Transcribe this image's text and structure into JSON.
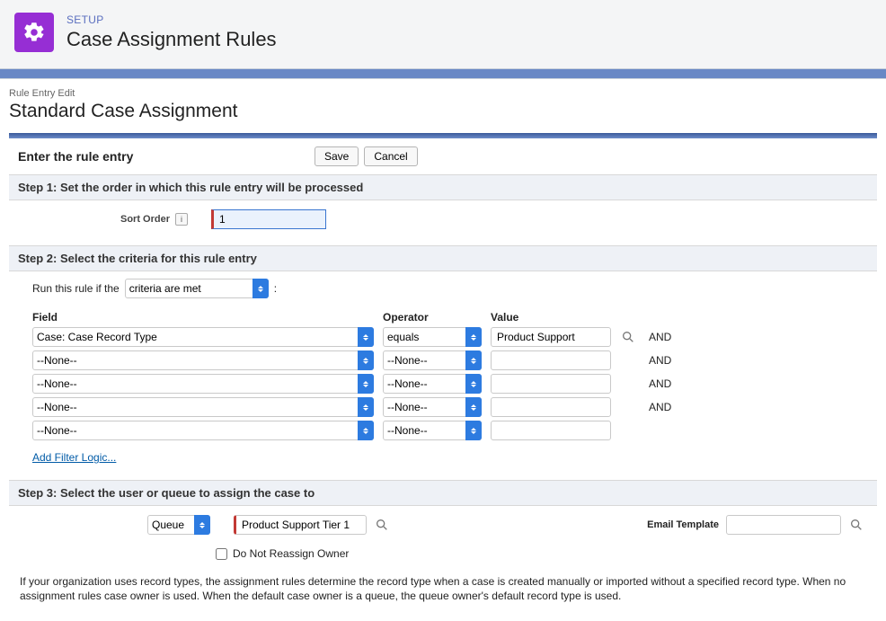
{
  "header": {
    "setup_label": "SETUP",
    "page_title": "Case Assignment Rules"
  },
  "breadcrumb": "Rule Entry Edit",
  "page_heading": "Standard Case Assignment",
  "lead_section": {
    "title": "Enter the rule entry",
    "save": "Save",
    "cancel": "Cancel"
  },
  "step1": {
    "title": "Step 1: Set the order in which this rule entry will be processed",
    "sort_label": "Sort Order",
    "sort_value": "1"
  },
  "step2": {
    "title": "Step 2: Select the criteria for this rule entry",
    "runif_prefix": "Run this rule if the",
    "runif_value": "criteria are met",
    "runif_suffix": " :",
    "columns": {
      "field": "Field",
      "operator": "Operator",
      "value": "Value"
    },
    "none_option": "--None--",
    "rows": [
      {
        "field": "Case: Case Record Type",
        "operator": "equals",
        "value": "Product Support",
        "conj": "AND"
      },
      {
        "field": "--None--",
        "operator": "--None--",
        "value": "",
        "conj": "AND"
      },
      {
        "field": "--None--",
        "operator": "--None--",
        "value": "",
        "conj": "AND"
      },
      {
        "field": "--None--",
        "operator": "--None--",
        "value": "",
        "conj": "AND"
      },
      {
        "field": "--None--",
        "operator": "--None--",
        "value": "",
        "conj": ""
      }
    ],
    "filter_link": "Add Filter Logic..."
  },
  "step3": {
    "title": "Step 3: Select the user or queue to assign the case to",
    "assign_type": "Queue",
    "assign_value": "Product Support Tier 1",
    "email_label": "Email Template",
    "email_value": "",
    "checkbox_label": "Do Not Reassign Owner",
    "description": "If your organization uses record types, the assignment rules determine the record type when a case is created manually or imported without a specified record type. When no assignment rules case owner is used. When the default case owner is a queue, the queue owner's default record type is used."
  }
}
